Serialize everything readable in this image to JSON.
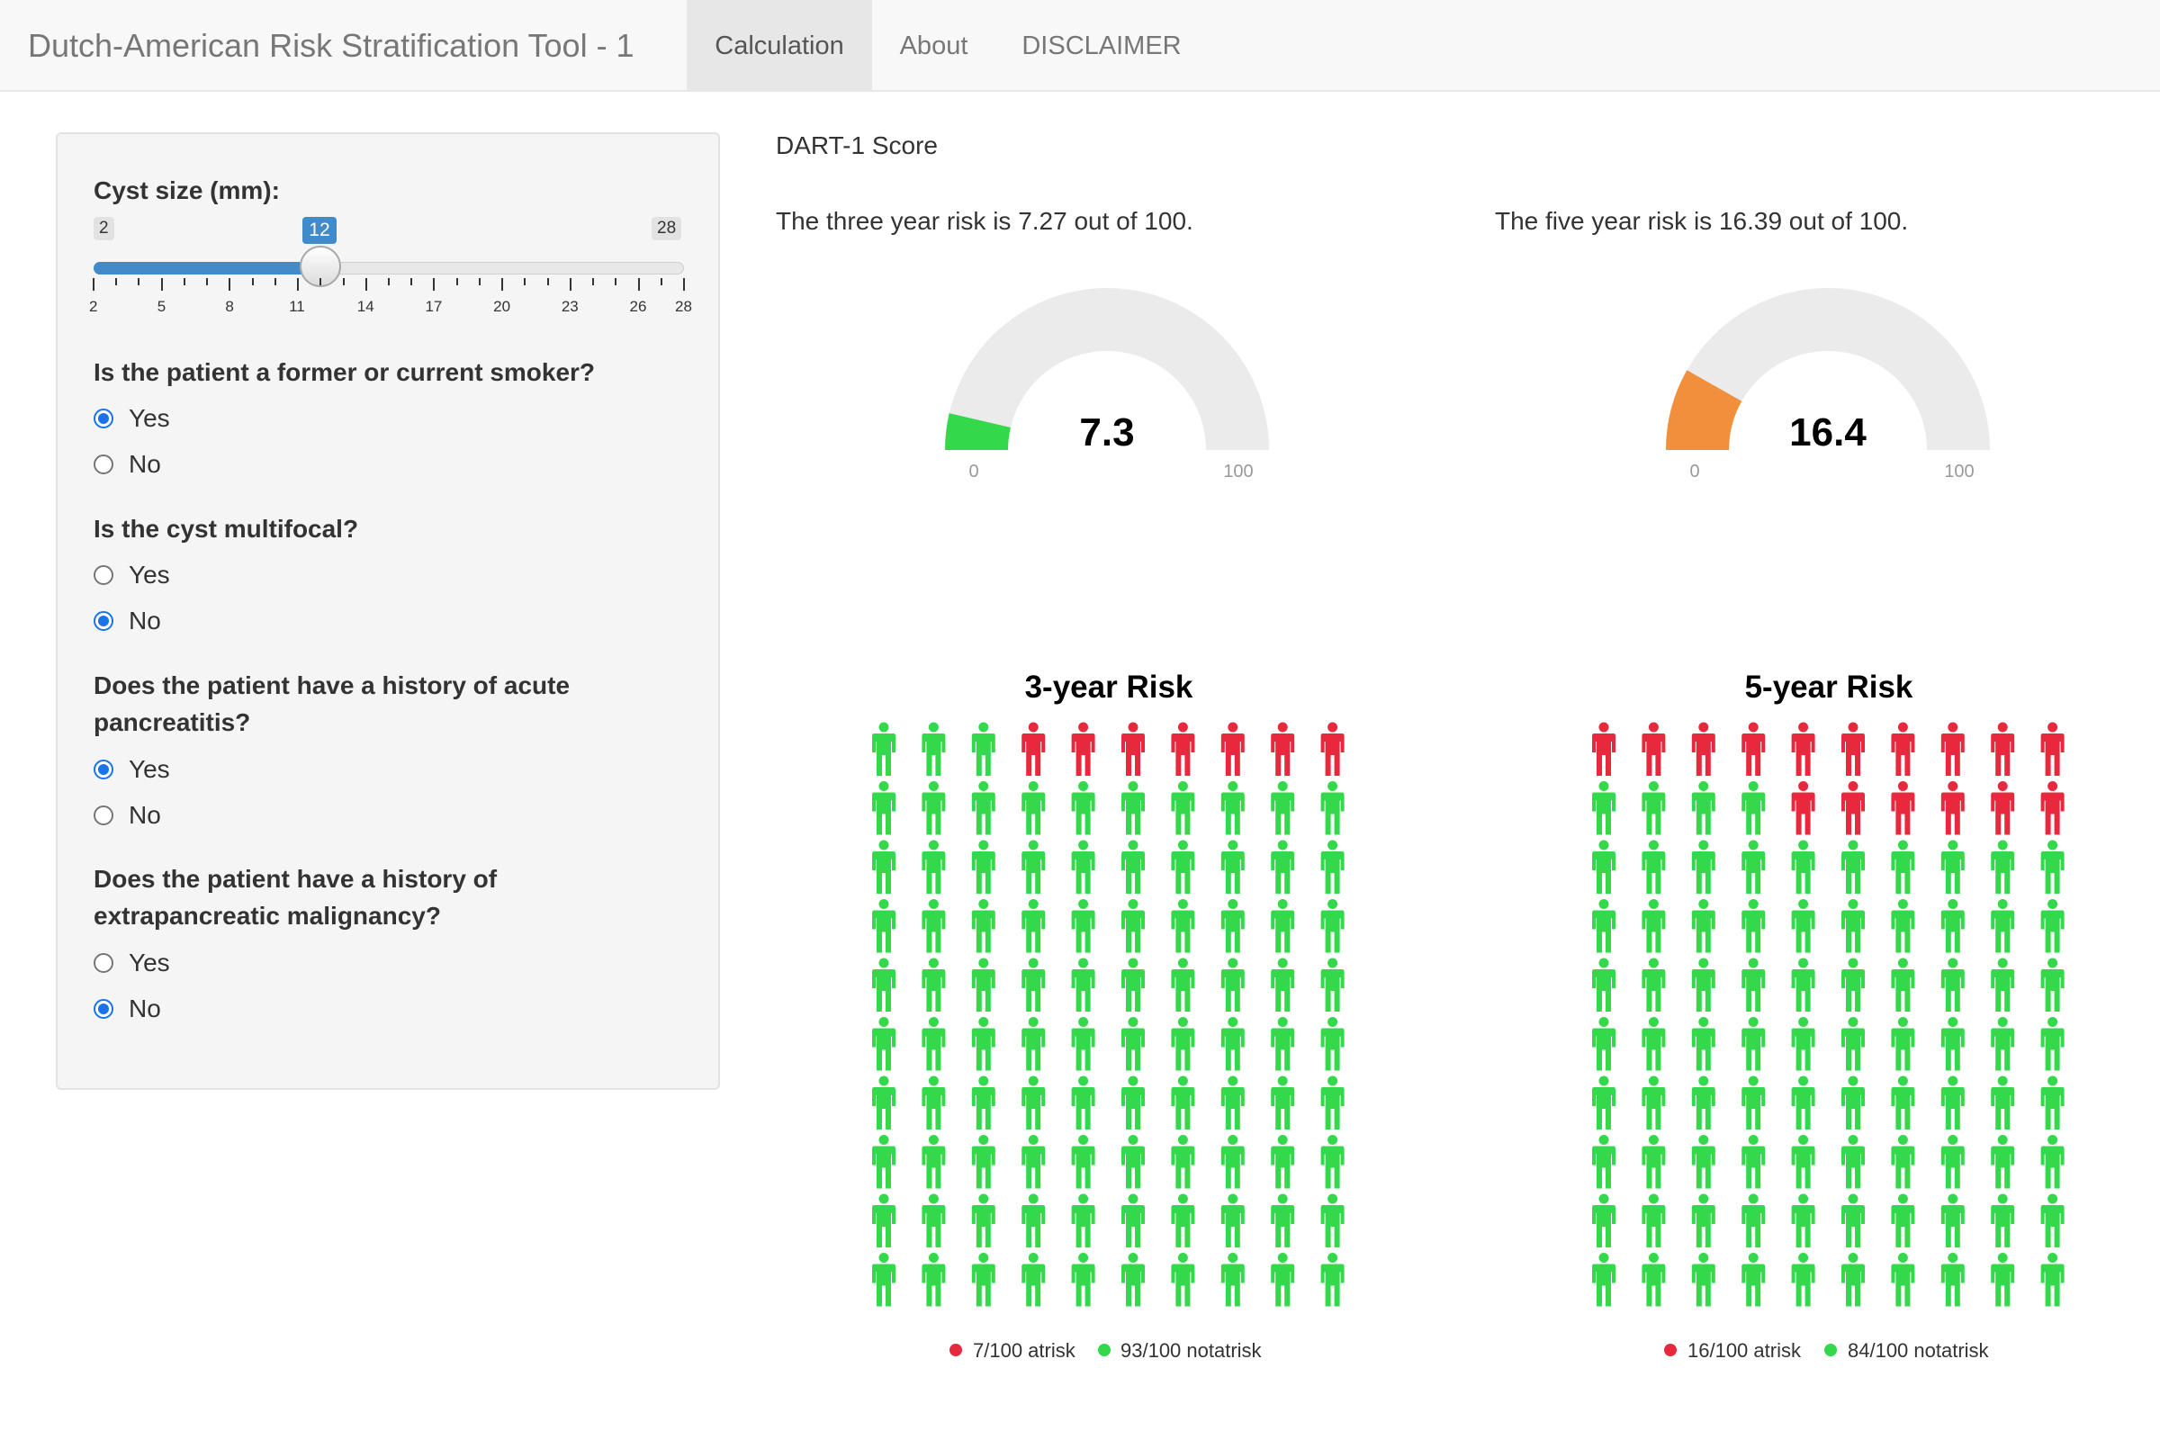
{
  "navbar": {
    "brand": "Dutch-American Risk Stratification Tool - 1",
    "tabs": [
      {
        "label": "Calculation",
        "active": true
      },
      {
        "label": "About",
        "active": false
      },
      {
        "label": "DISCLAIMER",
        "active": false
      }
    ]
  },
  "sidebar": {
    "cyst_size": {
      "label": "Cyst size (mm):",
      "min": 2,
      "max": 28,
      "value": 12,
      "min_label": "2",
      "max_label": "28",
      "value_label": "12",
      "ticks": [
        "2",
        "5",
        "8",
        "11",
        "14",
        "17",
        "20",
        "23",
        "26",
        "28"
      ]
    },
    "questions": [
      {
        "name": "smoker",
        "label_lines": [
          "Is the patient a former or current smoker?"
        ],
        "options": [
          "Yes",
          "No"
        ],
        "selected": "Yes"
      },
      {
        "name": "multifocal",
        "label_lines": [
          "Is the cyst multifocal?"
        ],
        "options": [
          "Yes",
          "No"
        ],
        "selected": "No"
      },
      {
        "name": "pancreatitis",
        "label_lines": [
          "Does the patient have a history of acute",
          "pancreatitis?"
        ],
        "options": [
          "Yes",
          "No"
        ],
        "selected": "Yes"
      },
      {
        "name": "malignancy",
        "label_lines": [
          "Does the patient have a history of",
          "extrapancreatic malignancy?"
        ],
        "options": [
          "Yes",
          "No"
        ],
        "selected": "No"
      }
    ]
  },
  "main": {
    "title": "DART-1 Score",
    "three_year_text": "The three year risk is 7.27 out of 100.",
    "five_year_text": "The five year risk is 16.39 out of 100."
  },
  "gauges": [
    {
      "name": "three-year",
      "value": 7.3,
      "value_label": "7.3",
      "min_label": "0",
      "max_label": "100",
      "max": 100,
      "color": "#33d94a"
    },
    {
      "name": "five-year",
      "value": 16.4,
      "value_label": "16.4",
      "min_label": "0",
      "max_label": "100",
      "max": 100,
      "color": "#f28f3b"
    }
  ],
  "chart_data": [
    {
      "type": "pictogram",
      "title": "3-year Risk",
      "total": 100,
      "columns": 10,
      "series": [
        {
          "name": "atrisk",
          "value": 7,
          "color": "#e8283c",
          "legend": "7/100 atrisk"
        },
        {
          "name": "notatrisk",
          "value": 93,
          "color": "#33d94a",
          "legend": "93/100 notatrisk"
        }
      ]
    },
    {
      "type": "pictogram",
      "title": "5-year Risk",
      "total": 100,
      "columns": 10,
      "series": [
        {
          "name": "atrisk",
          "value": 16,
          "color": "#e8283c",
          "legend": "16/100 atrisk"
        },
        {
          "name": "notatrisk",
          "value": 84,
          "color": "#33d94a",
          "legend": "84/100 notatrisk"
        }
      ]
    }
  ]
}
